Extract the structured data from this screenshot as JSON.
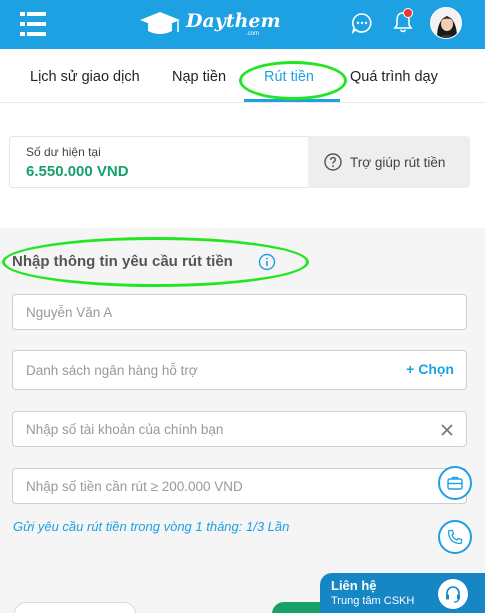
{
  "header": {
    "logo_text": "Daythem",
    "logo_subtext": ".com",
    "icons": [
      "menu-icon",
      "chat-icon",
      "bell-icon",
      "avatar"
    ],
    "brand_color": "#1da1e2",
    "notification_dot_color": "#e53935"
  },
  "tabs": [
    {
      "label": "Lịch sử giao dịch",
      "active": false
    },
    {
      "label": "Nạp tiền",
      "active": false
    },
    {
      "label": "Rút tiền",
      "active": true
    },
    {
      "label": "Quá trình dạy",
      "active": false
    }
  ],
  "balance": {
    "label": "Số dư hiện tại",
    "value": "6.550.000 VND",
    "value_color": "#16a06a",
    "help_label": "Trợ giúp rút tiền",
    "help_icon": "question-circle-icon"
  },
  "form": {
    "title": "Nhập thông tin yêu cầu rút tiền",
    "title_icon": "info-icon",
    "name_placeholder": "Nguyễn Văn A",
    "bank_label": "Danh sách ngân hàng hỗ trợ",
    "bank_choose": "+ Chọn",
    "account_placeholder": "Nhập số tài khoản của chính bạn",
    "amount_placeholder": "Nhập số tiền cần rút ≥ 200.000 VND",
    "note": "Gửi yêu cầu rút tiền trong vòng 1 tháng: 1/3 Lần"
  },
  "floating": {
    "icons": [
      "briefcase-icon",
      "phone-icon"
    ]
  },
  "contact": {
    "title": "Liên hệ",
    "subtitle": "Trung tâm CSKH",
    "icon": "headset-icon"
  },
  "annotations": {
    "highlight_color": "#22e622"
  }
}
